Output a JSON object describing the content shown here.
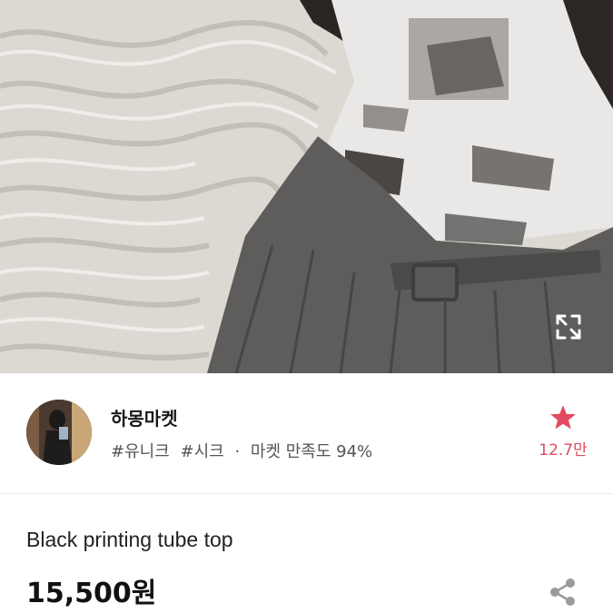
{
  "product_photo": {
    "alt": ""
  },
  "seller": {
    "name": "하몽마켓",
    "tags": [
      "#유니크",
      "#시크"
    ],
    "separator": "·",
    "satisfaction": "마켓 만족도 94%"
  },
  "favorite": {
    "icon": "star-icon",
    "count": "12.7만",
    "color": "#e14a5f"
  },
  "product": {
    "title": "Black printing tube top",
    "price": "15,500원"
  },
  "icons": {
    "expand": "expand-icon",
    "share": "share-icon"
  }
}
